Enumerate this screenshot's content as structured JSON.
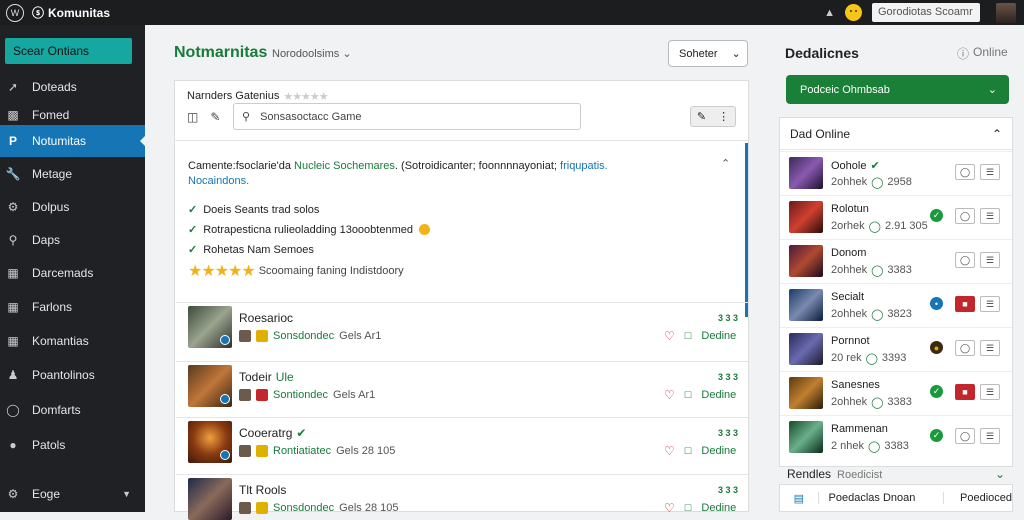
{
  "topbar": {
    "brand": "Komunitas",
    "search_text": "Gorodiotas Scoamr"
  },
  "sidebar": {
    "primary_button": "Scear Ontians",
    "items": [
      {
        "label": "Doteads",
        "icon": "pin-icon"
      },
      {
        "label": "Fomed",
        "icon": "briefcase-icon"
      },
      {
        "label": "Notumitas",
        "icon": "brand-icon",
        "active": true
      },
      {
        "label": "Metage",
        "icon": "wrench-icon"
      },
      {
        "label": "Dolpus",
        "icon": "gear-icon"
      },
      {
        "label": "Daps",
        "icon": "search-icon"
      },
      {
        "label": "Darcemads",
        "icon": "grid-icon"
      },
      {
        "label": "Farlons",
        "icon": "grid-icon"
      },
      {
        "label": "Komantias",
        "icon": "grid-icon"
      },
      {
        "label": "Poantolinos",
        "icon": "person-icon"
      },
      {
        "label": "Domfarts",
        "icon": "circle-icon"
      },
      {
        "label": "Patols",
        "icon": "dot-icon"
      },
      {
        "label": "Eoge",
        "icon": "gear-icon"
      }
    ]
  },
  "main": {
    "title": "Notmarnitas",
    "subtitle": "Norodoolsims",
    "sort_label": "Soheter",
    "panel": {
      "header": "Narnders Gatenius",
      "search_placeholder": "Sonsasoctacc Game",
      "review": {
        "text_a": "Camente:fsoclarie'da ",
        "text_green": "Nucleic Sochemares",
        "text_b": ". (Sotroidicanter; foonnnnayoniat;",
        "text_blue1": " friqupatis.",
        "text_blue2": "Nocaindons."
      },
      "checks": [
        "Doeis Seants trad solos",
        "Rotrapesticna rulieoladding 13ooobtenmed",
        "Rohetas Nam Semoes"
      ],
      "rating_text": "Scoomaing faning  Indistdoory",
      "games": [
        {
          "name": "Roesarioc",
          "seller": "Sonsdondec",
          "meta": "Gels Ar1",
          "action": "Dedine",
          "dots": "3 3 3"
        },
        {
          "name": "Todeir",
          "badge": "Ule",
          "seller": "Sontiondec",
          "meta": "Gels Ar1",
          "action": "Dedine",
          "dots": "3 3 3"
        },
        {
          "name": "Cooeratrg",
          "seller": "Rontiatiatec",
          "meta": "Gels 28 105",
          "action": "Dedine",
          "dots": "3 3 3"
        },
        {
          "name": "Tlt Rools",
          "seller": "Sonsdondec",
          "meta": "Gels 28 105",
          "action": "Dedine",
          "dots": "3 3 3"
        }
      ]
    }
  },
  "right": {
    "title": "Dedalicnes",
    "online_label": "Online",
    "button_label": "Podceic Ohmbsab",
    "list_header": "Dad Online",
    "rows": [
      {
        "name": "Oohole",
        "meta_a": "2ohhek",
        "meta_b": "2958",
        "verified": true
      },
      {
        "name": "Rolotun",
        "meta_a": "2orhek",
        "meta_b": "2.91 305",
        "status": "green"
      },
      {
        "name": "Donom",
        "meta_a": "2ohhek",
        "meta_b": "3383",
        "status": ""
      },
      {
        "name": "Secialt",
        "meta_a": "2ohhek",
        "meta_b": "3823",
        "status": "blue",
        "red_ctl": true
      },
      {
        "name": "Pornnot",
        "meta_a": "20 rek",
        "meta_b": "3393",
        "status": "dark"
      },
      {
        "name": "Sanesnes",
        "meta_a": "2ohhek",
        "meta_b": "3383",
        "status": "green",
        "red_ctl": true
      },
      {
        "name": "Rammenan",
        "meta_a": "2 nhek",
        "meta_b": "3383",
        "status": "green"
      }
    ],
    "footer_title": "Rendles",
    "footer_sub": "Roedicist",
    "bottom_label": "Poedaclas Dnoan",
    "bottom_right": "Poedioced"
  }
}
